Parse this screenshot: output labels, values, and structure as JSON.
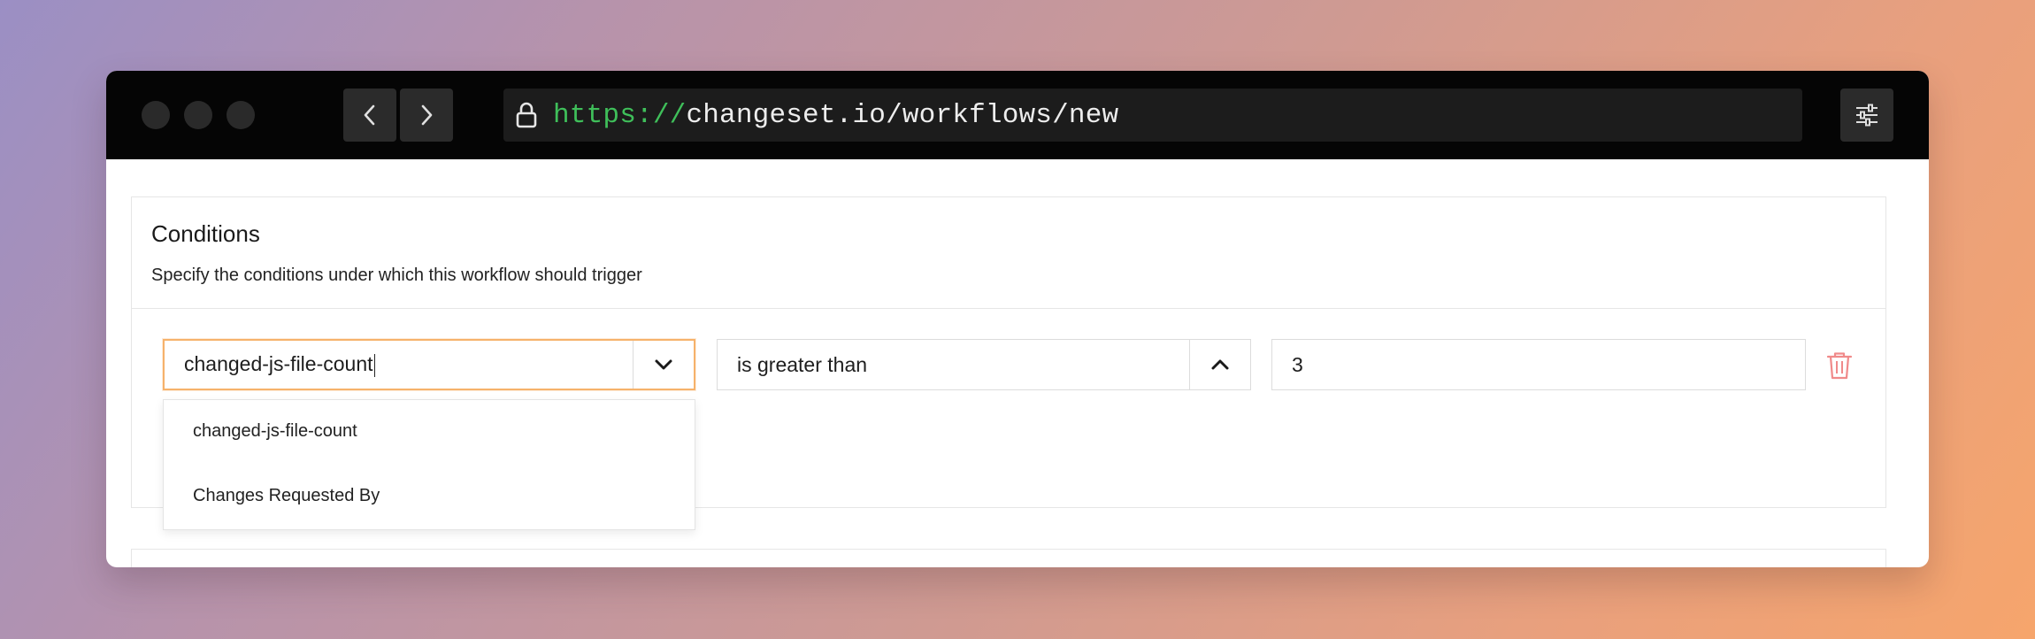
{
  "browser": {
    "url_scheme": "https://",
    "url_rest": "changeset.io/workflows/new"
  },
  "conditions": {
    "title": "Conditions",
    "description": "Specify the conditions under which this workflow should trigger",
    "field_input": {
      "value": "changed-js-file-count"
    },
    "operator_select": {
      "value": "is greater than"
    },
    "value_input": {
      "value": "3"
    },
    "field_options": [
      {
        "label": "changed-js-file-count"
      },
      {
        "label": "Changes Requested By"
      }
    ]
  },
  "icons": {
    "lock": "lock-icon",
    "back": "chevron-left-icon",
    "forward": "chevron-right-icon",
    "settings": "sliders-icon",
    "field_toggle": "chevron-down-icon",
    "operator_toggle": "chevron-up-icon",
    "delete": "trash-icon"
  },
  "colors": {
    "url_scheme": "#3fbf5a",
    "focus_border": "#f6b26b",
    "delete_icon": "#f08a8a"
  }
}
